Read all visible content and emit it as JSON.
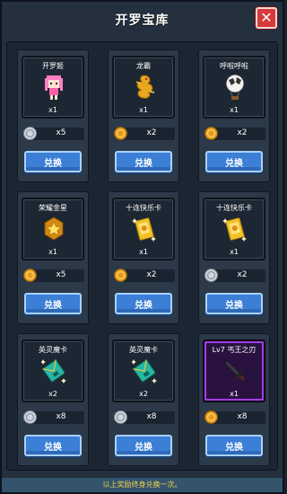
{
  "header": {
    "title": "开罗宝库",
    "close_label": "✕"
  },
  "cards": [
    {
      "name": "开罗姬",
      "qty": "x1",
      "cost": "x5",
      "coin": "silver",
      "icon": "pink-princess-icon",
      "button": "兑换"
    },
    {
      "name": "龙霸",
      "qty": "x1",
      "cost": "x2",
      "coin": "gold",
      "icon": "golden-dragon-icon",
      "button": "兑换"
    },
    {
      "name": "呼啦呼啦",
      "qty": "x1",
      "cost": "x2",
      "coin": "gold",
      "icon": "hot-air-balloon-icon",
      "button": "兑换"
    },
    {
      "name": "荣耀金星",
      "qty": "x1",
      "cost": "x5",
      "coin": "gold",
      "icon": "gold-star-badge-icon",
      "button": "兑换"
    },
    {
      "name": "十连快乐卡",
      "qty": "x1",
      "cost": "x2",
      "coin": "gold",
      "icon": "gold-card-icon",
      "button": "兑换"
    },
    {
      "name": "十连快乐卡",
      "qty": "x1",
      "cost": "x2",
      "coin": "silver",
      "icon": "gold-card-icon",
      "button": "兑换"
    },
    {
      "name": "英灵魔卡",
      "qty": "x2",
      "cost": "x8",
      "coin": "silver",
      "icon": "teal-magic-card-icon",
      "button": "兑换"
    },
    {
      "name": "英灵魔卡",
      "qty": "x2",
      "cost": "x8",
      "coin": "silver",
      "icon": "teal-magic-card-icon",
      "button": "兑换"
    },
    {
      "name": "Lv7 丐王之刃",
      "qty": "x1",
      "cost": "x8",
      "coin": "gold",
      "icon": "dark-blade-icon",
      "button": "兑换"
    }
  ],
  "footer": {
    "note": "以上奖励终身兑换一次。"
  },
  "colors": {
    "panel": "#24303e",
    "button_blue": "#3b7fd6",
    "footer_text": "#f2d54a",
    "gold_coin": "#e39b1f",
    "silver_coin": "#cfd6de",
    "rare_frame": "#a23fe6"
  }
}
